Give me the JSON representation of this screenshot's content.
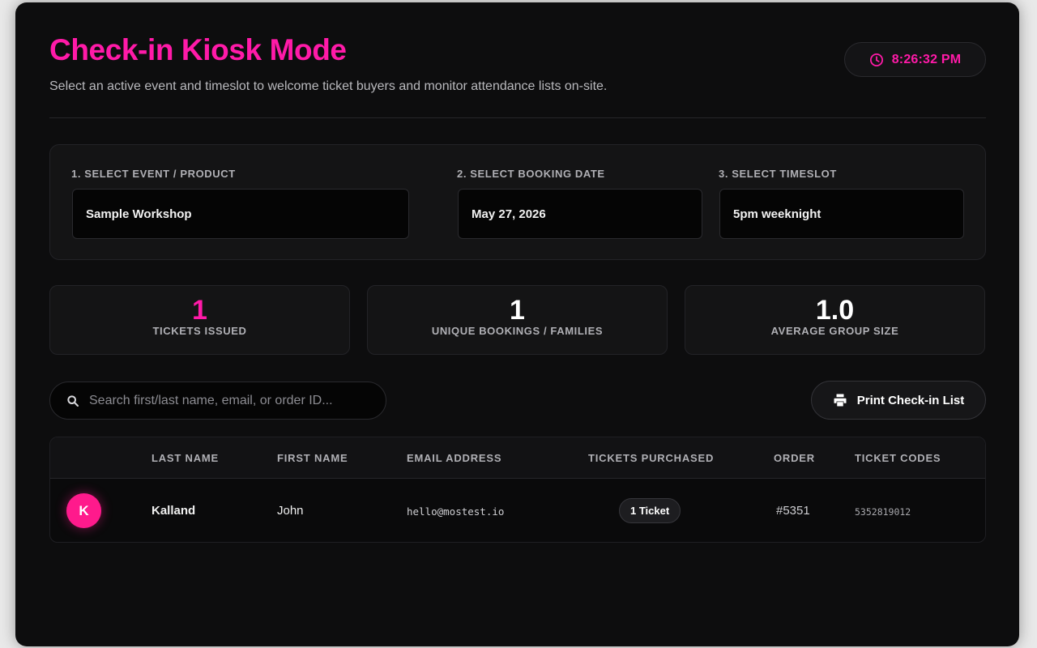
{
  "header": {
    "title": "Check-in Kiosk Mode",
    "subtitle": "Select an active event and timeslot to welcome ticket buyers and monitor attendance lists on-site.",
    "clock_time": "8:26:32 PM"
  },
  "selectors": {
    "event": {
      "label": "1. SELECT EVENT / PRODUCT",
      "value": "Sample Workshop"
    },
    "date": {
      "label": "2. SELECT BOOKING DATE",
      "value": "May 27, 2026"
    },
    "timeslot": {
      "label": "3. SELECT TIMESLOT",
      "value": "5pm weeknight"
    }
  },
  "stats": [
    {
      "value": "1",
      "label": "TICKETS ISSUED"
    },
    {
      "value": "1",
      "label": "UNIQUE BOOKINGS / FAMILIES"
    },
    {
      "value": "1.0",
      "label": "AVERAGE GROUP SIZE"
    }
  ],
  "search": {
    "placeholder": "Search first/last name, email, or order ID..."
  },
  "print_button": {
    "label": "Print Check-in List"
  },
  "table": {
    "headers": {
      "last_name": "LAST NAME",
      "first_name": "FIRST NAME",
      "email": "EMAIL ADDRESS",
      "tickets": "TICKETS PURCHASED",
      "order": "ORDER",
      "codes": "TICKET CODES"
    },
    "rows": [
      {
        "initial": "K",
        "last_name": "Kalland",
        "first_name": "John",
        "email": "hello@mostest.io",
        "tickets": "1 Ticket",
        "order": "#5351",
        "codes": "5352819012"
      }
    ]
  },
  "colors": {
    "accent": "#ff1aa8",
    "panel_bg": "#0d0d0e",
    "card_bg": "#141415"
  },
  "icons": {
    "clock": "clock-icon",
    "search": "search-icon",
    "print": "printer-icon"
  }
}
